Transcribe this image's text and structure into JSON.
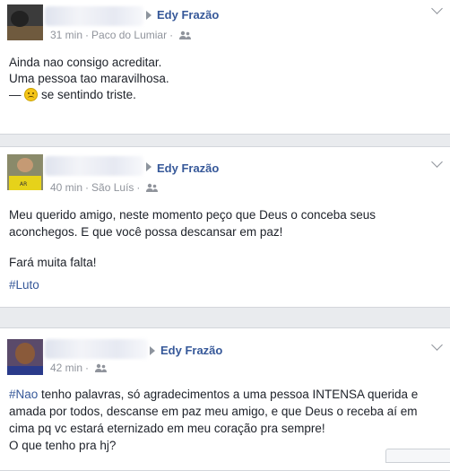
{
  "posts": [
    {
      "author": "Edy Frazão",
      "time": "31 min",
      "location": "Paco do Lumiar",
      "lines": [
        "Ainda nao consigo acreditar.",
        "Uma pessoa tao maravilhosa."
      ],
      "feeling_prefix": "—",
      "feeling_text": "se sentindo triste.",
      "feeling_icon": "sad-emoji-icon"
    },
    {
      "author": "Edy Frazão",
      "time": "40 min",
      "location": "São Luís",
      "paragraph1": "Meu querido amigo, neste momento peço que Deus o conceba seus aconchegos. E que você possa descansar em paz!",
      "paragraph2": "Fará muita falta!",
      "hashtag": "#Luto"
    },
    {
      "author": "Edy Frazão",
      "time": "42 min",
      "hashtag": "#Nao",
      "body": " tenho palavras, só agradecimentos a uma pessoa INTENSA querida e amada por todos, descanse em paz meu amigo, e que Deus o receba aí em cima pq vc estará eternizado em meu coração pra sempre!",
      "line2": "O que tenho pra hj?"
    }
  ],
  "colors": {
    "link": "#365899",
    "meta": "#90949c",
    "text": "#1d2129",
    "background": "#e9ebee"
  },
  "icons": {
    "audience": "friends-icon",
    "menu": "chevron-down-icon",
    "arrow": "triangle-right-icon"
  }
}
